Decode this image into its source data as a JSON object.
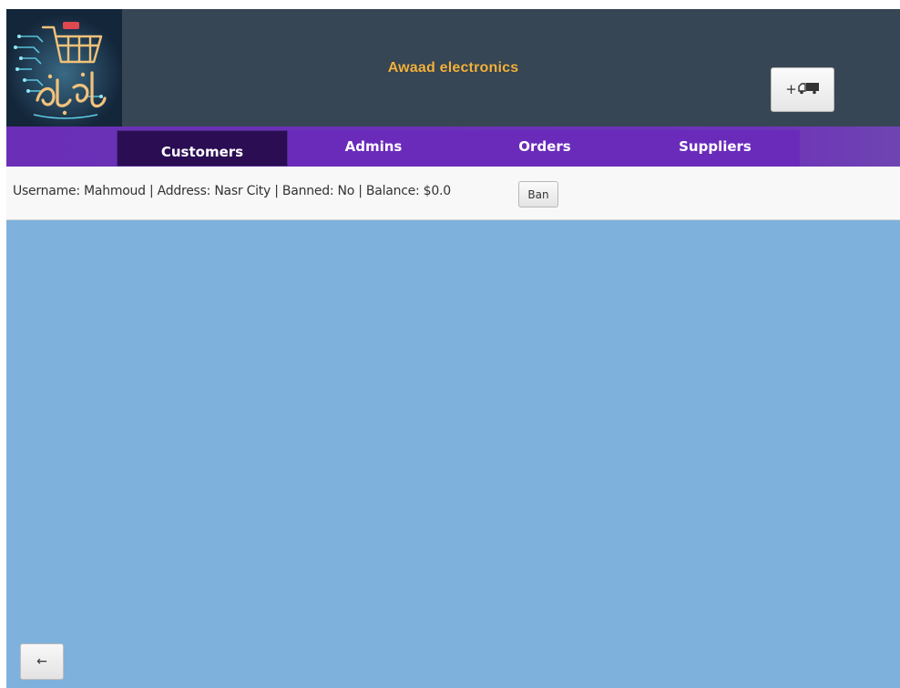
{
  "app": {
    "title": "Awaad electronics"
  },
  "header": {
    "logo_icon": "shopping-cart-circuit-logo",
    "truck_button": {
      "plus": "+",
      "icon": "delivery-truck-icon"
    }
  },
  "tabs": [
    {
      "label": "Customers",
      "active": true
    },
    {
      "label": "Admins",
      "active": false
    },
    {
      "label": "Orders",
      "active": false
    },
    {
      "label": "Suppliers",
      "active": false
    }
  ],
  "customers": [
    {
      "summary": "Username: Mahmoud | Address: Nasr City | Banned: No | Balance: $0.0",
      "action_label": "Ban"
    }
  ],
  "footer": {
    "back_label": "←"
  },
  "colors": {
    "header_bg": "#374655",
    "title": "#f2b33d",
    "tabbar_bg": "#6a2fb6",
    "active_tab_bg": "#2b0d54",
    "content_bg": "#7eb1dc"
  }
}
